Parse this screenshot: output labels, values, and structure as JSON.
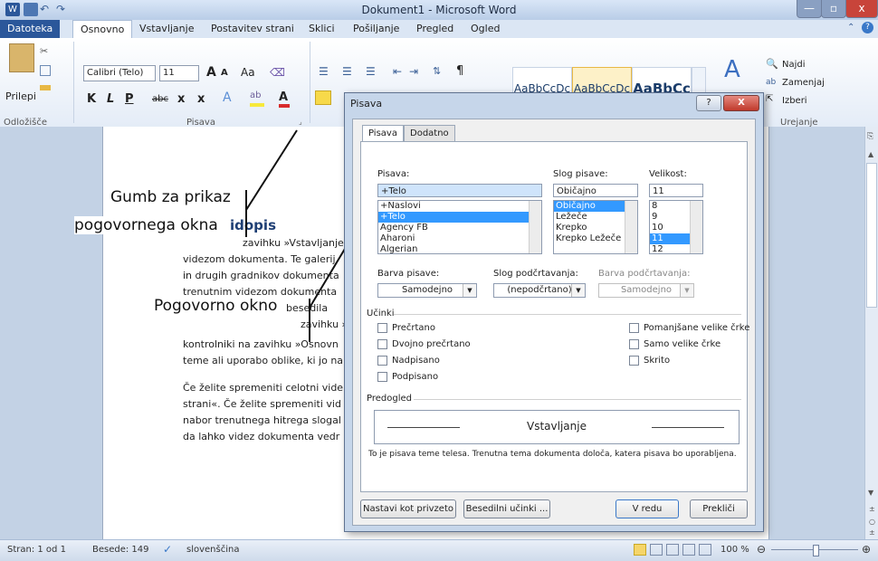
{
  "window": {
    "title": "Dokument1 - Microsoft Word",
    "min_glyph": "—",
    "max_glyph": "▫",
    "close_glyph": "x"
  },
  "tabs": [
    "Datoteka",
    "Osnovno",
    "Vstavljanje",
    "Postavitev strani",
    "Sklici",
    "Pošiljanje",
    "Pregled",
    "Ogled"
  ],
  "ribbon": {
    "clipboard": {
      "paste": "Prilepi",
      "group": "Odložišče"
    },
    "font": {
      "name": "Calibri (Telo)",
      "size": "11",
      "grow": "A",
      "shrink": "A",
      "case": "Aa",
      "bold": "K",
      "italic": "L",
      "underline": "P",
      "strike": "abc",
      "sub": "x",
      "sup": "x",
      "group": "Pisava"
    },
    "paragraph": {
      "pilcrow": "¶"
    },
    "styles": [
      "AaBbCcDc",
      "AaBbCcDc",
      "AaBbCc"
    ],
    "editing": {
      "find": "Najdi",
      "replace": "Zamenjaj",
      "select": "Izberi",
      "group": "Urejanje"
    }
  },
  "document": {
    "heading": "idopis",
    "lines": [
      "zavihku »Vstavljanje",
      "videzom dokumenta. Te galerij",
      "in drugih gradnikov dokumenta",
      "trenutnim videzom dokumenta",
      "besedila",
      "zavihku »",
      "kontrolniki na zavihku »Osnovn",
      "teme ali uporabo oblike, ki jo na",
      "Če želite spremeniti celotni vide",
      "strani«. Če želite spremeniti vid",
      "nabor trenutnega hitrega slogal",
      "da lahko videz dokumenta vedr"
    ]
  },
  "annotations": {
    "button_label_line1": "Gumb za prikaz",
    "button_label_line2": "pogovornega okna",
    "dialog_label": "Pogovorno okno"
  },
  "dialog": {
    "title": "Pisava",
    "help": "?",
    "close": "X",
    "tabs": [
      "Pisava",
      "Dodatno"
    ],
    "font_label": "Pisava:",
    "font_value": "+Telo",
    "font_list": [
      "+Naslovi",
      "+Telo",
      "Agency FB",
      "Aharoni",
      "Algerian"
    ],
    "style_label": "Slog pisave:",
    "style_value": "Običajno",
    "style_list": [
      "Običajno",
      "Ležeče",
      "Krepko",
      "Krepko Ležeče"
    ],
    "size_label": "Velikost:",
    "size_value": "11",
    "size_list": [
      "8",
      "9",
      "10",
      "11",
      "12"
    ],
    "color_label": "Barva pisave:",
    "color_value": "Samodejno",
    "underline_label": "Slog podčrtavanja:",
    "underline_value": "(nepodčrtano)",
    "underline_color_label": "Barva podčrtavanja:",
    "underline_color_value": "Samodejno",
    "effects_label": "Učinki",
    "effects_left": [
      "Prečrtano",
      "Dvojno prečrtano",
      "Nadpisano",
      "Podpisano"
    ],
    "effects_right": [
      "Pomanjšane velike črke",
      "Samo velike črke",
      "Skrito"
    ],
    "preview_label": "Predogled",
    "preview_text": "Vstavljanje",
    "preview_note": "To je pisava teme telesa. Trenutna tema dokumenta določa, katera pisava bo uporabljena.",
    "btn_default": "Nastavi kot privzeto",
    "btn_effects": "Besedilni učinki ...",
    "btn_ok": "V redu",
    "btn_cancel": "Prekliči"
  },
  "status": {
    "page": "Stran: 1 od 1",
    "words": "Besede: 149",
    "lang": "slovenščina",
    "zoom": "100 %"
  }
}
